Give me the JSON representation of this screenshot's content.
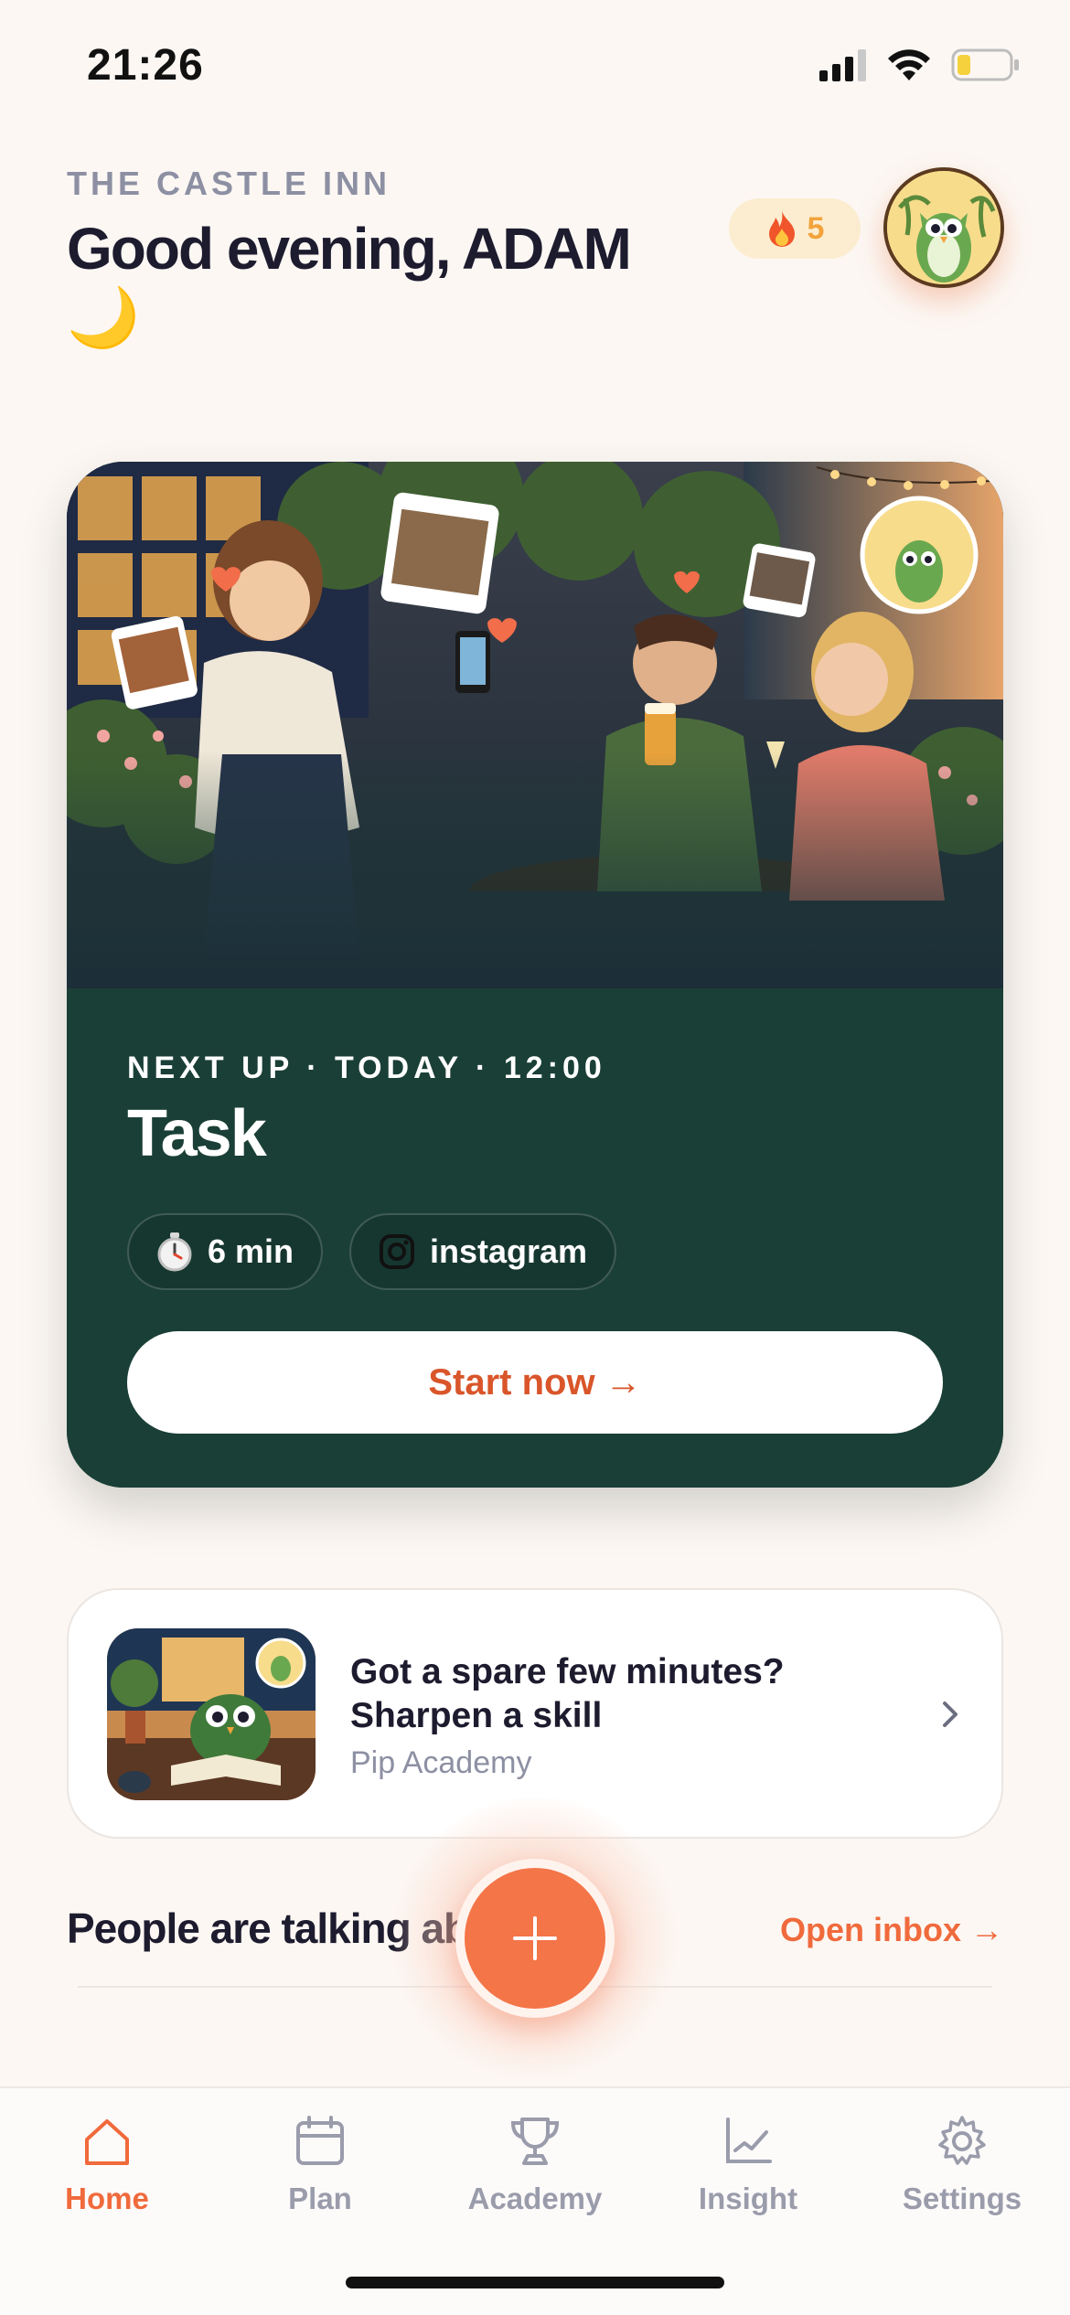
{
  "status_bar": {
    "time": "21:26"
  },
  "header": {
    "venue": "THE CASTLE INN",
    "greeting": "Good evening, ADAM",
    "greeting_emoji": "🌙",
    "streak": {
      "icon": "fire-icon",
      "count": "5"
    },
    "avatar": "owl-mascot-avatar"
  },
  "hero": {
    "image": "illustration-waitress-photographing-pub-guests",
    "next_up": "NEXT UP · TODAY · 12:00",
    "title": "Task",
    "duration": {
      "icon": "stopwatch-icon",
      "label": "6 min"
    },
    "platform": {
      "icon": "instagram-icon",
      "label": "instagram"
    },
    "cta": "Start now →"
  },
  "academy_card": {
    "title": "Got a spare few minutes? Sharpen a skill",
    "subtitle": "Pip Academy",
    "thumbnail": "owl-reading-book-illustration"
  },
  "conversations": {
    "title": "People are talking about you",
    "action": "Open inbox →"
  },
  "fab": {
    "icon": "plus-icon"
  },
  "tabs": [
    {
      "label": "Home",
      "icon": "home-icon",
      "active": true
    },
    {
      "label": "Plan",
      "icon": "calendar-icon",
      "active": false
    },
    {
      "label": "Academy",
      "icon": "trophy-icon",
      "active": false
    },
    {
      "label": "Insight",
      "icon": "chart-icon",
      "active": false
    },
    {
      "label": "Settings",
      "icon": "gear-icon",
      "active": false
    }
  ],
  "colors": {
    "background": "#fcf7f3",
    "accent": "#f06a3c",
    "card_green": "#1a3f36",
    "text_dark": "#1d1b2e",
    "text_muted": "#8d90a3"
  }
}
